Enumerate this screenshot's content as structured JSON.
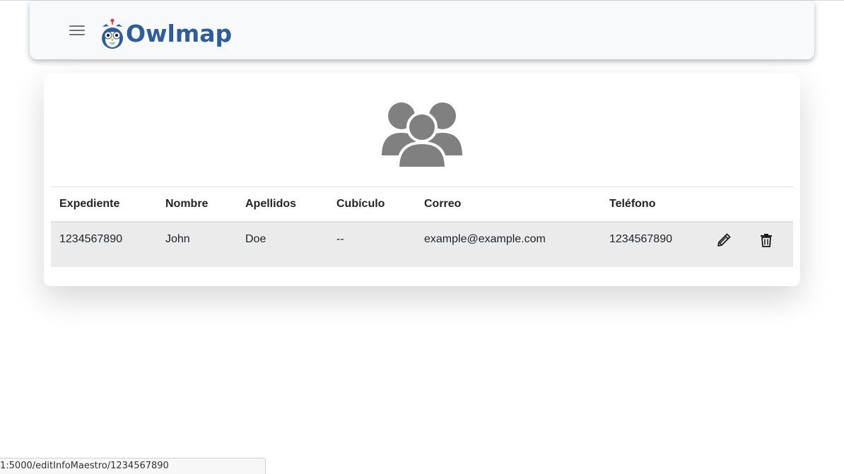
{
  "brand": {
    "logo_text": "Owlmap",
    "logo_color": "#2f5d9a"
  },
  "nav": {
    "menu_icon": "hamburger-icon"
  },
  "card": {
    "header_icon": "users-icon",
    "icon_color": "#808080"
  },
  "table": {
    "columns": [
      "Expediente",
      "Nombre",
      "Apellidos",
      "Cubículo",
      "Correo",
      "Teléfono"
    ],
    "rows": [
      {
        "expediente": "1234567890",
        "nombre": "John",
        "apellidos": "Doe",
        "cubiculo": "--",
        "correo": "example@example.com",
        "telefono": "1234567890",
        "edit_icon": "pencil-icon",
        "delete_icon": "trash-icon"
      }
    ],
    "row_background": "#ebebeb"
  },
  "status_bar": {
    "url": "1:5000/editInfoMaestro/1234567890"
  }
}
